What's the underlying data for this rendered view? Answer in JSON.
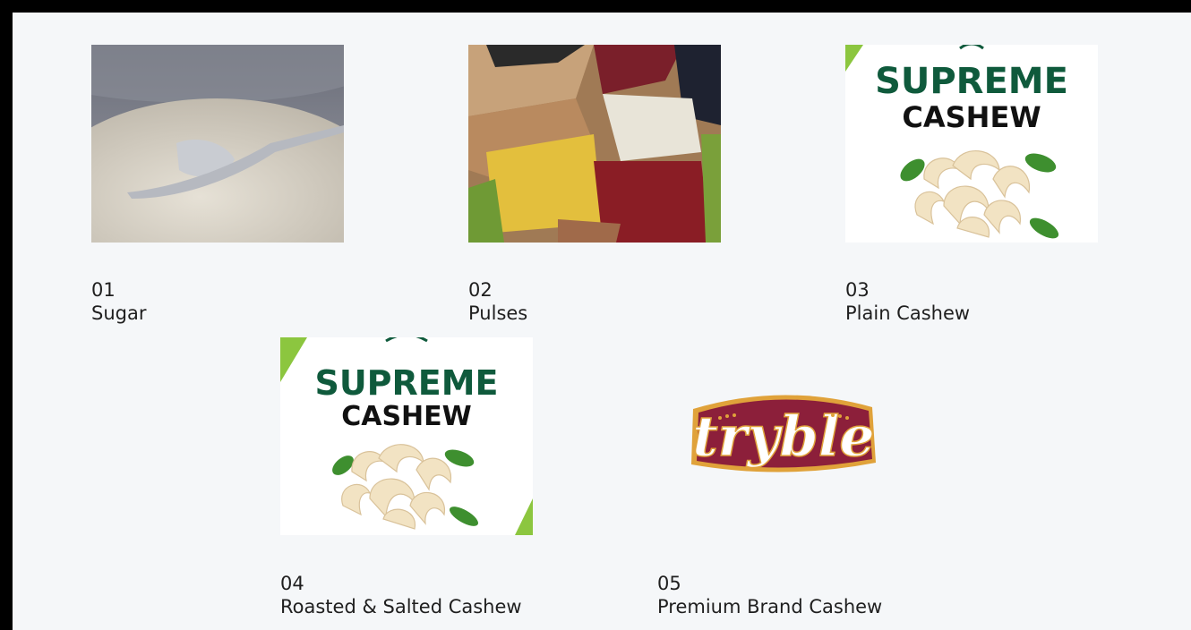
{
  "products": [
    {
      "number": "01",
      "name": "Sugar",
      "image": "sugar-bowl-with-spoon"
    },
    {
      "number": "02",
      "name": "Pulses",
      "image": "assorted-pulses-and-beans"
    },
    {
      "number": "03",
      "name": "Plain Cashew",
      "image": "supreme-cashew-packaging"
    },
    {
      "number": "04",
      "name": "Roasted & Salted Cashew",
      "image": "supreme-cashew-packaging"
    },
    {
      "number": "05",
      "name": "Premium Brand Cashew",
      "image": "tryble-brand-logo"
    }
  ],
  "brands": {
    "supreme_line1": "SUPREME",
    "supreme_line2": "CASHEW",
    "tryble": "tryble"
  },
  "colors": {
    "background": "#f5f7f9",
    "supreme_green": "#0f5a3c",
    "tryble_maroon": "#8c1f3a",
    "tryble_gold": "#e0a23a",
    "accent_lime": "#8cc63f"
  }
}
